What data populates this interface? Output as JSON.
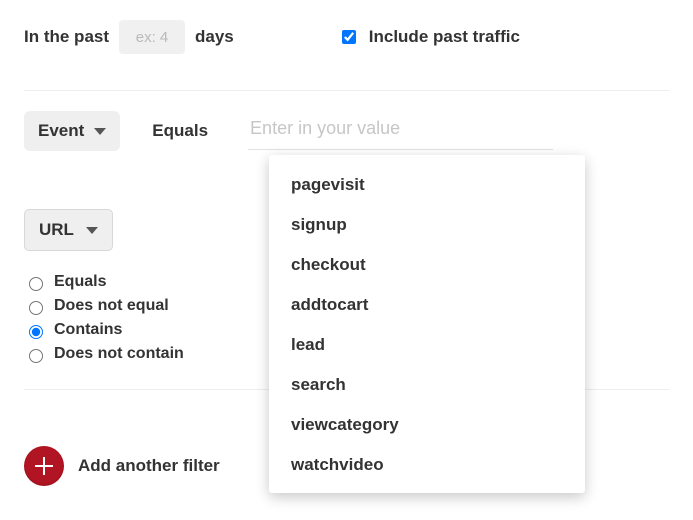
{
  "days_filter": {
    "prefix": "In the past",
    "placeholder": "ex: 4",
    "suffix": "days",
    "include_past_label": "Include past traffic",
    "include_past_checked": true
  },
  "event_filter": {
    "dropdown_label": "Event",
    "operator": "Equals",
    "value_placeholder": "Enter in your value",
    "options": [
      "pagevisit",
      "signup",
      "checkout",
      "addtocart",
      "lead",
      "search",
      "viewcategory",
      "watchvideo"
    ]
  },
  "url_filter": {
    "dropdown_label": "URL",
    "operators": [
      {
        "label": "Equals",
        "selected": false
      },
      {
        "label": "Does not equal",
        "selected": false
      },
      {
        "label": "Contains",
        "selected": true
      },
      {
        "label": "Does not contain",
        "selected": false
      }
    ]
  },
  "add_filter": {
    "label": "Add another filter"
  }
}
